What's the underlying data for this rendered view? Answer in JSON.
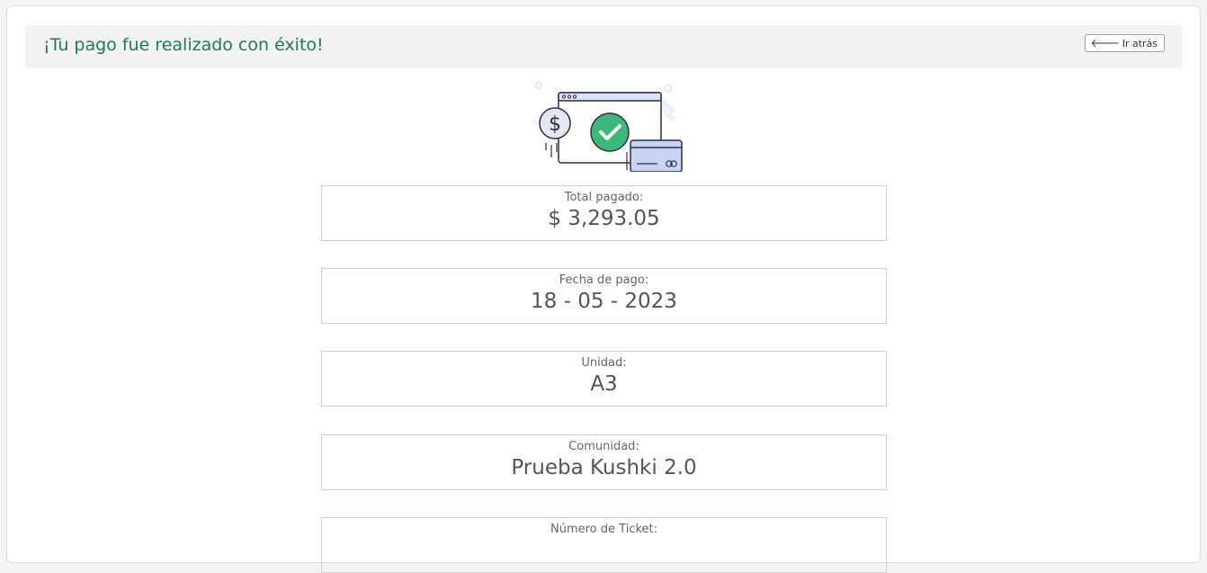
{
  "header": {
    "title": "¡Tu pago fue realizado con éxito!",
    "back_label": "Ir atrás"
  },
  "illustration": {
    "icons": [
      "dollar-coin-icon",
      "browser-window-icon",
      "check-circle-icon",
      "credit-card-icon"
    ],
    "colors": {
      "check": "#3cb878",
      "card": "#c9d4f3",
      "outline": "#2c2f48"
    }
  },
  "details": [
    {
      "label": "Total pagado:",
      "value": "$ 3,293.05"
    },
    {
      "label": "Fecha de pago:",
      "value": "18 - 05 - 2023"
    },
    {
      "label": "Unidad:",
      "value": "A3"
    },
    {
      "label": "Comunidad:",
      "value": "Prueba Kushki 2.0"
    },
    {
      "label": "Número de Ticket:",
      "value": ""
    }
  ],
  "colors": {
    "accent_title": "#1f7a5c",
    "header_bg": "#f2f2f2"
  }
}
